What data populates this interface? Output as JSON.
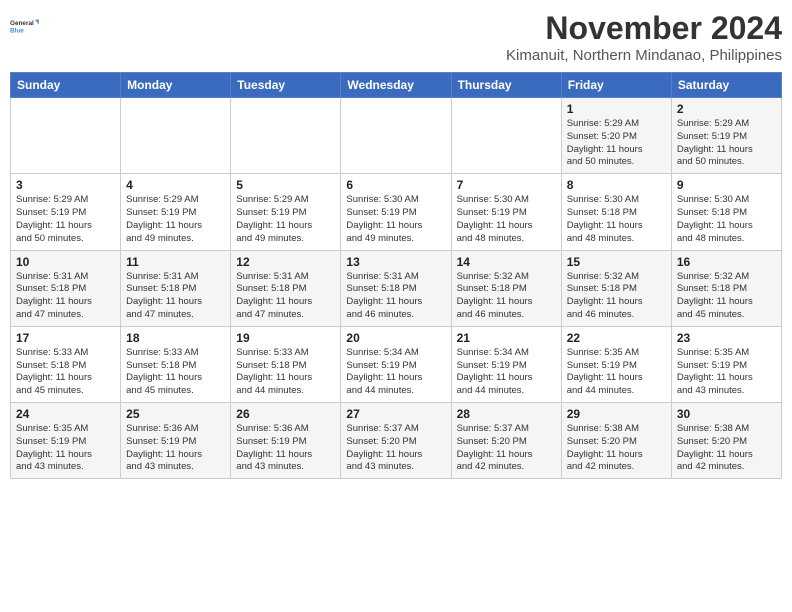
{
  "logo": {
    "line1": "General",
    "line2": "Blue"
  },
  "title": {
    "month_year": "November 2024",
    "location": "Kimanuit, Northern Mindanao, Philippines"
  },
  "days_of_week": [
    "Sunday",
    "Monday",
    "Tuesday",
    "Wednesday",
    "Thursday",
    "Friday",
    "Saturday"
  ],
  "weeks": [
    [
      {
        "day": "",
        "info": ""
      },
      {
        "day": "",
        "info": ""
      },
      {
        "day": "",
        "info": ""
      },
      {
        "day": "",
        "info": ""
      },
      {
        "day": "",
        "info": ""
      },
      {
        "day": "1",
        "info": "Sunrise: 5:29 AM\nSunset: 5:20 PM\nDaylight: 11 hours\nand 50 minutes."
      },
      {
        "day": "2",
        "info": "Sunrise: 5:29 AM\nSunset: 5:19 PM\nDaylight: 11 hours\nand 50 minutes."
      }
    ],
    [
      {
        "day": "3",
        "info": "Sunrise: 5:29 AM\nSunset: 5:19 PM\nDaylight: 11 hours\nand 50 minutes."
      },
      {
        "day": "4",
        "info": "Sunrise: 5:29 AM\nSunset: 5:19 PM\nDaylight: 11 hours\nand 49 minutes."
      },
      {
        "day": "5",
        "info": "Sunrise: 5:29 AM\nSunset: 5:19 PM\nDaylight: 11 hours\nand 49 minutes."
      },
      {
        "day": "6",
        "info": "Sunrise: 5:30 AM\nSunset: 5:19 PM\nDaylight: 11 hours\nand 49 minutes."
      },
      {
        "day": "7",
        "info": "Sunrise: 5:30 AM\nSunset: 5:19 PM\nDaylight: 11 hours\nand 48 minutes."
      },
      {
        "day": "8",
        "info": "Sunrise: 5:30 AM\nSunset: 5:18 PM\nDaylight: 11 hours\nand 48 minutes."
      },
      {
        "day": "9",
        "info": "Sunrise: 5:30 AM\nSunset: 5:18 PM\nDaylight: 11 hours\nand 48 minutes."
      }
    ],
    [
      {
        "day": "10",
        "info": "Sunrise: 5:31 AM\nSunset: 5:18 PM\nDaylight: 11 hours\nand 47 minutes."
      },
      {
        "day": "11",
        "info": "Sunrise: 5:31 AM\nSunset: 5:18 PM\nDaylight: 11 hours\nand 47 minutes."
      },
      {
        "day": "12",
        "info": "Sunrise: 5:31 AM\nSunset: 5:18 PM\nDaylight: 11 hours\nand 47 minutes."
      },
      {
        "day": "13",
        "info": "Sunrise: 5:31 AM\nSunset: 5:18 PM\nDaylight: 11 hours\nand 46 minutes."
      },
      {
        "day": "14",
        "info": "Sunrise: 5:32 AM\nSunset: 5:18 PM\nDaylight: 11 hours\nand 46 minutes."
      },
      {
        "day": "15",
        "info": "Sunrise: 5:32 AM\nSunset: 5:18 PM\nDaylight: 11 hours\nand 46 minutes."
      },
      {
        "day": "16",
        "info": "Sunrise: 5:32 AM\nSunset: 5:18 PM\nDaylight: 11 hours\nand 45 minutes."
      }
    ],
    [
      {
        "day": "17",
        "info": "Sunrise: 5:33 AM\nSunset: 5:18 PM\nDaylight: 11 hours\nand 45 minutes."
      },
      {
        "day": "18",
        "info": "Sunrise: 5:33 AM\nSunset: 5:18 PM\nDaylight: 11 hours\nand 45 minutes."
      },
      {
        "day": "19",
        "info": "Sunrise: 5:33 AM\nSunset: 5:18 PM\nDaylight: 11 hours\nand 44 minutes."
      },
      {
        "day": "20",
        "info": "Sunrise: 5:34 AM\nSunset: 5:19 PM\nDaylight: 11 hours\nand 44 minutes."
      },
      {
        "day": "21",
        "info": "Sunrise: 5:34 AM\nSunset: 5:19 PM\nDaylight: 11 hours\nand 44 minutes."
      },
      {
        "day": "22",
        "info": "Sunrise: 5:35 AM\nSunset: 5:19 PM\nDaylight: 11 hours\nand 44 minutes."
      },
      {
        "day": "23",
        "info": "Sunrise: 5:35 AM\nSunset: 5:19 PM\nDaylight: 11 hours\nand 43 minutes."
      }
    ],
    [
      {
        "day": "24",
        "info": "Sunrise: 5:35 AM\nSunset: 5:19 PM\nDaylight: 11 hours\nand 43 minutes."
      },
      {
        "day": "25",
        "info": "Sunrise: 5:36 AM\nSunset: 5:19 PM\nDaylight: 11 hours\nand 43 minutes."
      },
      {
        "day": "26",
        "info": "Sunrise: 5:36 AM\nSunset: 5:19 PM\nDaylight: 11 hours\nand 43 minutes."
      },
      {
        "day": "27",
        "info": "Sunrise: 5:37 AM\nSunset: 5:20 PM\nDaylight: 11 hours\nand 43 minutes."
      },
      {
        "day": "28",
        "info": "Sunrise: 5:37 AM\nSunset: 5:20 PM\nDaylight: 11 hours\nand 42 minutes."
      },
      {
        "day": "29",
        "info": "Sunrise: 5:38 AM\nSunset: 5:20 PM\nDaylight: 11 hours\nand 42 minutes."
      },
      {
        "day": "30",
        "info": "Sunrise: 5:38 AM\nSunset: 5:20 PM\nDaylight: 11 hours\nand 42 minutes."
      }
    ]
  ]
}
